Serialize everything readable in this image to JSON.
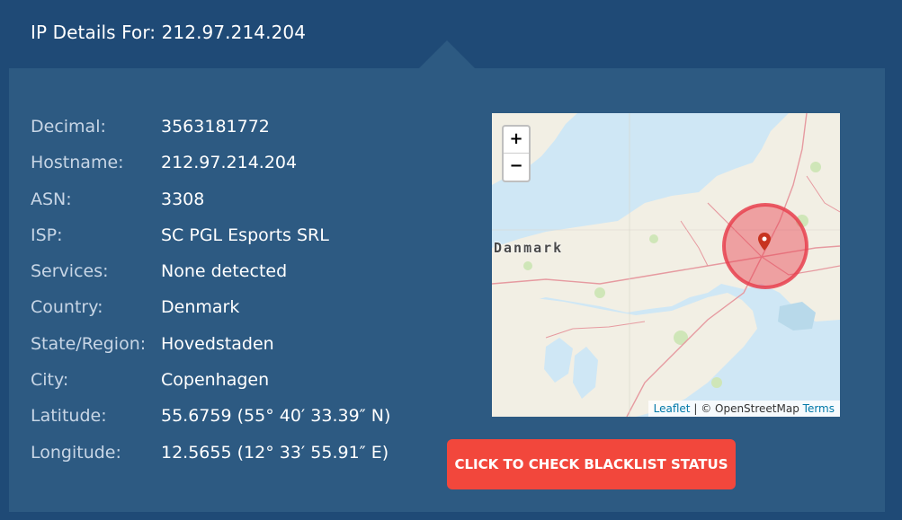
{
  "header": {
    "title": "IP Details For: 212.97.214.204"
  },
  "details": [
    {
      "label": "Decimal:",
      "value": "3563181772"
    },
    {
      "label": "Hostname:",
      "value": "212.97.214.204"
    },
    {
      "label": "ASN:",
      "value": "3308"
    },
    {
      "label": "ISP:",
      "value": "SC PGL Esports SRL"
    },
    {
      "label": "Services:",
      "value": "None detected"
    },
    {
      "label": "Country:",
      "value": "Denmark"
    },
    {
      "label": "State/Region:",
      "value": "Hovedstaden"
    },
    {
      "label": "City:",
      "value": "Copenhagen"
    },
    {
      "label": "Latitude:",
      "value": "55.6759 (55° 40′ 33.39″ N)"
    },
    {
      "label": "Longitude:",
      "value": "12.5655 (12° 33′ 55.91″ E)"
    }
  ],
  "map": {
    "country_label": "Danmark",
    "zoom_in_label": "+",
    "zoom_out_label": "−",
    "attribution_leaflet": "Leaflet",
    "attribution_sep": " | © OpenStreetMap ",
    "attribution_terms": "Terms",
    "circle_color": "#e8414f"
  },
  "blacklist_button": {
    "label": "CLICK TO CHECK BLACKLIST STATUS"
  },
  "colors": {
    "background": "#1f4a76",
    "panel": "#2d5a82",
    "button": "#f2473c"
  }
}
